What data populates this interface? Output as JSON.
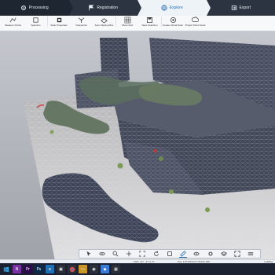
{
  "workflow_tabs": [
    {
      "label": "Processing",
      "icon": "gear-icon"
    },
    {
      "label": "Registration",
      "icon": "flag-icon"
    },
    {
      "label": "Explore",
      "icon": "globe-icon"
    },
    {
      "label": "Export",
      "icon": "export-icon"
    }
  ],
  "ribbon": [
    {
      "label": "Measure Points",
      "icon": "measure-icon"
    },
    {
      "label": "Selection",
      "icon": "select-icon"
    },
    {
      "label": "Scan Properties",
      "icon": "scan-icon"
    },
    {
      "label": "Viewpoints",
      "icon": "viewpoint-icon"
    },
    {
      "label": "Auto Clipping Box",
      "icon": "clipbox-icon"
    },
    {
      "label": "Show Grid",
      "icon": "grid-icon"
    },
    {
      "label": "Save Selection",
      "icon": "save-icon"
    },
    {
      "label": "Create Virtual Scan",
      "icon": "virtual-scan-icon"
    },
    {
      "label": "Project Point Cloud",
      "icon": "cloud-icon"
    }
  ],
  "viewport_tools": [
    "pointer-icon",
    "orbit-icon",
    "zoom-icon",
    "pan-icon",
    "fit-icon",
    "rotate-icon",
    "clip-icon",
    "ruler-icon",
    "eye-icon",
    "settings-icon",
    "layers-icon",
    "fullscreen-icon",
    "menu-icon"
  ],
  "status": {
    "view": "View: 117 · 47 m  77",
    "position": "Pos: 172.578  22.9  78.0/11.396",
    "loading": "Loading"
  },
  "taskbar": [
    {
      "icon": "windows-start-icon",
      "color": "#1b2130"
    },
    {
      "icon": "onenote-icon",
      "color": "#7a2fa6"
    },
    {
      "icon": "premiere-icon",
      "color": "#2a0a4a"
    },
    {
      "icon": "photoshop-icon",
      "color": "#0b2a4a"
    },
    {
      "icon": "edge-icon",
      "color": "#1f6fb5"
    },
    {
      "icon": "store-icon",
      "color": "#2a2f3a"
    },
    {
      "icon": "chrome-icon",
      "color": "#2a2f3a"
    },
    {
      "icon": "folder-icon",
      "color": "#c7952a"
    },
    {
      "icon": "media-icon",
      "color": "#2a2f3a"
    },
    {
      "icon": "scene-icon",
      "color": "#3a7bd5"
    },
    {
      "icon": "app-icon",
      "color": "#2a2f3a"
    }
  ],
  "colors": {
    "tab_bar": "#2b3440",
    "tab_active": "#eef3f8",
    "accent": "#2b6fb4"
  }
}
